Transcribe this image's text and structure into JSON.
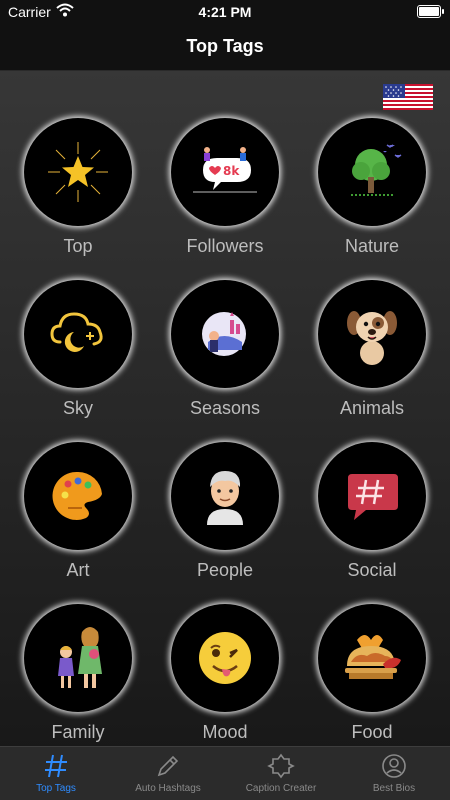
{
  "status_bar": {
    "carrier": "Carrier",
    "time": "4:21 PM"
  },
  "nav": {
    "title": "Top Tags"
  },
  "language_flag": {
    "icon": "us-flag-icon"
  },
  "categories": [
    {
      "label": "Top",
      "icon": "star-icon"
    },
    {
      "label": "Followers",
      "icon": "followers-icon"
    },
    {
      "label": "Nature",
      "icon": "tree-icon"
    },
    {
      "label": "Sky",
      "icon": "cloud-moon-icon"
    },
    {
      "label": "Seasons",
      "icon": "seasons-icon"
    },
    {
      "label": "Animals",
      "icon": "dog-icon"
    },
    {
      "label": "Art",
      "icon": "palette-icon"
    },
    {
      "label": "People",
      "icon": "person-icon"
    },
    {
      "label": "Social",
      "icon": "hashtag-bubble-icon"
    },
    {
      "label": "Family",
      "icon": "family-icon"
    },
    {
      "label": "Mood",
      "icon": "winking-emoji-icon"
    },
    {
      "label": "Food",
      "icon": "taco-icon"
    }
  ],
  "tabs": [
    {
      "label": "Top Tags",
      "icon": "hashtag-icon",
      "active": true
    },
    {
      "label": "Auto Hashtags",
      "icon": "pencil-icon",
      "active": false
    },
    {
      "label": "Caption Creater",
      "icon": "caption-frame-icon",
      "active": false
    },
    {
      "label": "Best Bios",
      "icon": "profile-circle-icon",
      "active": false
    }
  ],
  "colors": {
    "accent": "#2f8cff",
    "label": "#bdbdbd",
    "tab_inactive": "#8a8a8a"
  }
}
